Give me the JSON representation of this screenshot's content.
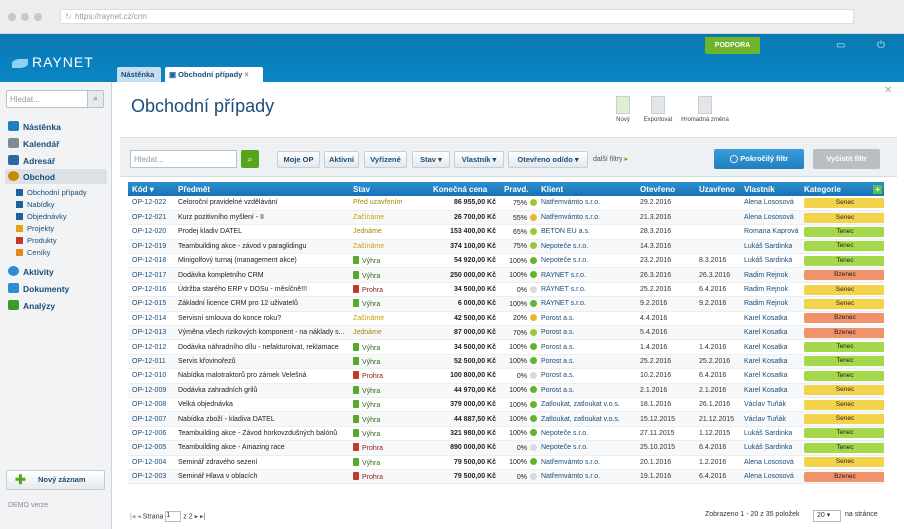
{
  "browser": {
    "url": "https://raynet.cz/crm"
  },
  "app": {
    "logo": "RAYNET",
    "support": "PODPORA"
  },
  "sidebar": {
    "search_placeholder": "Hledat...",
    "items": [
      {
        "label": "Nástěnka",
        "color": "#1f7fc0"
      },
      {
        "label": "Kalendář",
        "color": "#7d8c96"
      },
      {
        "label": "Adresář",
        "color": "#2a6aa3"
      },
      {
        "label": "Obchod",
        "color": "#c98a00"
      },
      {
        "label": "Aktivity",
        "color": "#2a8fd0"
      },
      {
        "label": "Dokumenty",
        "color": "#2a8fd0"
      },
      {
        "label": "Analýzy",
        "color": "#3b9a2a"
      }
    ],
    "subitems": [
      {
        "label": "Obchodní případy",
        "color": "#1f5f9a"
      },
      {
        "label": "Nabídky",
        "color": "#1f5f9a"
      },
      {
        "label": "Objednávky",
        "color": "#1f5f9a"
      },
      {
        "label": "Projekty",
        "color": "#e2a51a"
      },
      {
        "label": "Produkty",
        "color": "#c0392b"
      },
      {
        "label": "Ceníky",
        "color": "#e08a1a"
      }
    ],
    "new_record": "Nový záznam",
    "demo": "DEMO verze"
  },
  "tabs": [
    {
      "label": "Nástěnka"
    },
    {
      "label": "Obchodní případy"
    }
  ],
  "page": {
    "title": "Obchodní případy"
  },
  "toolbar": {
    "new": "Nový",
    "export": "Exportovat",
    "bulk": "Hromadná změna"
  },
  "filters": {
    "search_placeholder": "Hledat...",
    "buttons": [
      "Moje OP",
      "Aktivní",
      "Vyřízené",
      "Stav",
      "Vlastník",
      "Otevřeno od/do"
    ],
    "more": "další filtry",
    "advanced": "Pokročilý filtr",
    "clear": "Vyčistit filtr"
  },
  "table": {
    "headers": [
      "Kód",
      "Předmět",
      "Stav",
      "Konečná cena",
      "Pravd.",
      "Klient",
      "Otevřeno",
      "Uzavřeno",
      "Vlastník",
      "Kategorie"
    ],
    "rows": [
      [
        "OP-12-022",
        "Celoroční pravidelné vzdělávání",
        "Před uzavřením",
        "86 955,00 Kč",
        "75%",
        "Natřemvámto s.r.o.",
        "29.2.2016",
        "",
        "Alena Lososová",
        "Senec"
      ],
      [
        "OP-12-021",
        "Kurz pozitivního myšlení - II",
        "Začínáme",
        "26 700,00 Kč",
        "55%",
        "Natřemvámto s.r.o.",
        "21.3.2016",
        "",
        "Alena Lososová",
        "Senec"
      ],
      [
        "OP-12-020",
        "Prodej kladiv DATEL",
        "Jednáme",
        "153 400,00 Kč",
        "65%",
        "BETON EU a.s.",
        "28.3.2016",
        "",
        "Romana Kaprová",
        "Tenec"
      ],
      [
        "OP-12-019",
        "Teambuilding akce - závod v paraglidingu",
        "Začínáme",
        "374 100,00 Kč",
        "75%",
        "Nepoteče s.r.o.",
        "14.3.2016",
        "",
        "Lukáš Sardinka",
        "Tenec"
      ],
      [
        "OP-12-018",
        "Minigolfový turnaj (management akce)",
        "Výhra",
        "54 920,00 Kč",
        "100%",
        "Nepoteče s.r.o.",
        "23.2.2016",
        "8.3.2016",
        "Lukáš Sardinka",
        "Tenec"
      ],
      [
        "OP-12-017",
        "Dodávka kompletního CRM",
        "Výhra",
        "250 000,00 Kč",
        "100%",
        "RAYNET s.r.o.",
        "26.3.2016",
        "26.3.2016",
        "Radim Rejnok",
        "Bzenec"
      ],
      [
        "OP-12-016",
        "Údržba starého ERP v DOSu - měsíčně!!!",
        "Prohra",
        "34 500,00 Kč",
        "0%",
        "RAYNET s.r.o.",
        "25.2.2016",
        "6.4.2016",
        "Radim Rejnok",
        "Senec"
      ],
      [
        "OP-12-015",
        "Základní licence CRM pro 12 uživatelů",
        "Výhra",
        "6 000,00 Kč",
        "100%",
        "RAYNET s.r.o.",
        "9.2.2016",
        "9.2.2016",
        "Radim Rejnok",
        "Senec"
      ],
      [
        "OP-12-014",
        "Servisní smlouva do konce roku?",
        "Začínáme",
        "42 500,00 Kč",
        "20%",
        "Porost a.s.",
        "4.4.2016",
        "",
        "Karel Kosatka",
        "Bzenec"
      ],
      [
        "OP-12-013",
        "Výměna všech rizikových komponent - na náklady s...",
        "Jednáme",
        "87 000,00 Kč",
        "70%",
        "Porost a.s.",
        "5.4.2016",
        "",
        "Karel Kosatka",
        "Bzenec"
      ],
      [
        "OP-12-012",
        "Dodávka náhradního dílu - nefakturoivat, reklamace",
        "Výhra",
        "34 500,00 Kč",
        "100%",
        "Porost a.s.",
        "1.4.2016",
        "1.4.2016",
        "Karel Kosatka",
        "Tenec"
      ],
      [
        "OP-12-011",
        "Servis křovinořezů",
        "Výhra",
        "52 500,00 Kč",
        "100%",
        "Porost a.s.",
        "25.2.2016",
        "25.2.2016",
        "Karel Kosatka",
        "Tenec"
      ],
      [
        "OP-12-010",
        "Nabídka malotraktorů pro zámek Veleŝná",
        "Prohra",
        "100 800,00 Kč",
        "0%",
        "Porost a.s.",
        "10.2.2016",
        "6.4.2016",
        "Karel Kosatka",
        "Tenec"
      ],
      [
        "OP-12-009",
        "Dodávka zahradních grilů",
        "Výhra",
        "44 970,00 Kč",
        "100%",
        "Porost a.s.",
        "2.1.2016",
        "2.1.2016",
        "Karel Kosatka",
        "Senec"
      ],
      [
        "OP-12-008",
        "Velká objednávka",
        "Výhra",
        "379 000,00 Kč",
        "100%",
        "Zatloukat, zatloukat v.o.s.",
        "18.1.2016",
        "26.1.2016",
        "Václav Tuňák",
        "Senec"
      ],
      [
        "OP-12-007",
        "Nabídka zboží - kladiva DATEL",
        "Výhra",
        "44 887,50 Kč",
        "100%",
        "Zatloukat, zatloukat v.o.s.",
        "15.12.2015",
        "21.12.2015",
        "Václav Tuňák",
        "Senec"
      ],
      [
        "OP-12-006",
        "Teambuilding akce - Závod horkovzdušných balónů",
        "Výhra",
        "321 980,00 Kč",
        "100%",
        "Nepoteče s.r.o.",
        "27.11.2015",
        "1.12.2015",
        "Lukáš Sardinka",
        "Tenec"
      ],
      [
        "OP-12-005",
        "Teambuilding akce - Amazing race",
        "Prohra",
        "890 000,00 Kč",
        "0%",
        "Nepoteče s.r.o.",
        "25.10.2015",
        "6.4.2016",
        "Lukáš Sardinka",
        "Tenec"
      ],
      [
        "OP-12-004",
        "Seminář zdravého sezení",
        "Výhra",
        "79 500,00 Kč",
        "100%",
        "Natřemvámto s.r.o.",
        "20.1.2016",
        "1.2.2016",
        "Alena Lososová",
        "Senec"
      ],
      [
        "OP-12-003",
        "Seminář Hlava v oblacích",
        "Prohra",
        "79 500,00 Kč",
        "0%",
        "Natřemvámto s.r.o.",
        "19.1.2016",
        "6.4.2016",
        "Alena Lososová",
        "Bzenec"
      ]
    ]
  },
  "colors": {
    "Senec": "#f3d34a",
    "Tenec": "#a5d84b",
    "Bzenec": "#f0926a"
  },
  "footer": {
    "page_label": "Strana",
    "page": "1",
    "of": "z 2",
    "summary": "Zobrazeno 1 - 20 z 35 položek",
    "per_page": "20",
    "per_page_label": "na stránce"
  }
}
